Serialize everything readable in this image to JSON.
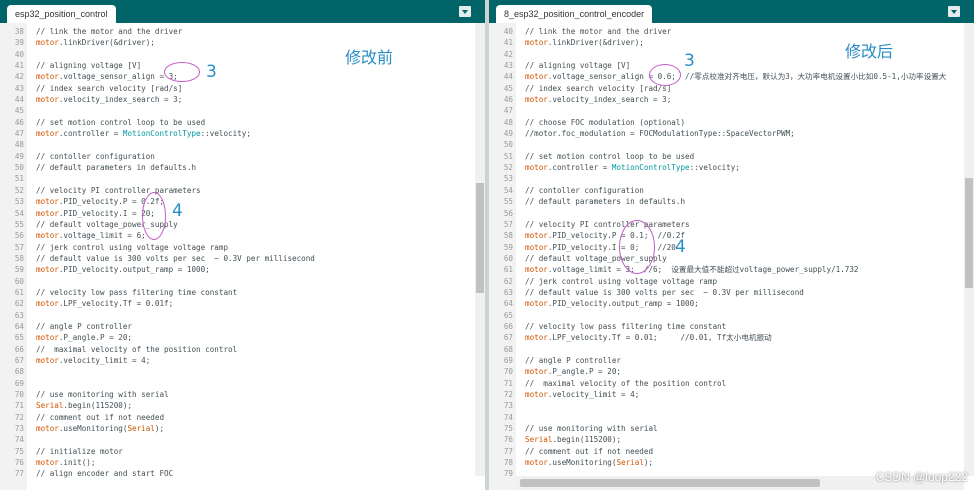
{
  "left": {
    "tab_label": "esp32_position_control",
    "annotation": "修改前",
    "mark_voltage": "3",
    "mark_pid": "4",
    "lines": [
      {
        "n": "38",
        "t": "// link the motor and the driver"
      },
      {
        "n": "39",
        "t": "motor.linkDriver(&driver);"
      },
      {
        "n": "40",
        "t": ""
      },
      {
        "n": "41",
        "t": "// aligning voltage [V]"
      },
      {
        "n": "42",
        "t": "motor.voltage_sensor_align = 3;"
      },
      {
        "n": "43",
        "t": "// index search velocity [rad/s]"
      },
      {
        "n": "44",
        "t": "motor.velocity_index_search = 3;"
      },
      {
        "n": "45",
        "t": ""
      },
      {
        "n": "46",
        "t": "// set motion control loop to be used"
      },
      {
        "n": "47",
        "t": "motor.controller = MotionControlType::velocity;"
      },
      {
        "n": "48",
        "t": ""
      },
      {
        "n": "49",
        "t": "// contoller configuration"
      },
      {
        "n": "50",
        "t": "// default parameters in defaults.h"
      },
      {
        "n": "51",
        "t": ""
      },
      {
        "n": "52",
        "t": "// velocity PI controller parameters"
      },
      {
        "n": "53",
        "t": "motor.PID_velocity.P = 0.2f;"
      },
      {
        "n": "54",
        "t": "motor.PID_velocity.I = 20;"
      },
      {
        "n": "55",
        "t": "// default voltage_power_supply"
      },
      {
        "n": "56",
        "t": "motor.voltage_limit = 6;"
      },
      {
        "n": "57",
        "t": "// jerk control using voltage voltage ramp"
      },
      {
        "n": "58",
        "t": "// default value is 300 volts per sec  ~ 0.3V per millisecond"
      },
      {
        "n": "59",
        "t": "motor.PID_velocity.output_ramp = 1000;"
      },
      {
        "n": "60",
        "t": ""
      },
      {
        "n": "61",
        "t": "// velocity low pass filtering time constant"
      },
      {
        "n": "62",
        "t": "motor.LPF_velocity.Tf = 0.01f;"
      },
      {
        "n": "63",
        "t": ""
      },
      {
        "n": "64",
        "t": "// angle P controller"
      },
      {
        "n": "65",
        "t": "motor.P_angle.P = 20;"
      },
      {
        "n": "66",
        "t": "//  maximal velocity of the position control"
      },
      {
        "n": "67",
        "t": "motor.velocity_limit = 4;"
      },
      {
        "n": "68",
        "t": ""
      },
      {
        "n": "69",
        "t": ""
      },
      {
        "n": "70",
        "t": "// use monitoring with serial"
      },
      {
        "n": "71",
        "t": "Serial.begin(115200);"
      },
      {
        "n": "72",
        "t": "// comment out if not needed"
      },
      {
        "n": "73",
        "t": "motor.useMonitoring(Serial);"
      },
      {
        "n": "74",
        "t": ""
      },
      {
        "n": "75",
        "t": "// initialize motor"
      },
      {
        "n": "76",
        "t": "motor.init();"
      },
      {
        "n": "77",
        "t": "// align encoder and start FOC"
      }
    ]
  },
  "right": {
    "tab_label": "8_esp32_position_control_encoder",
    "annotation": "修改后",
    "mark_voltage": "3",
    "mark_pid": "4",
    "lines": [
      {
        "n": "40",
        "t": "// link the motor and the driver"
      },
      {
        "n": "41",
        "t": "motor.linkDriver(&driver);"
      },
      {
        "n": "42",
        "t": ""
      },
      {
        "n": "43",
        "t": "// aligning voltage [V]"
      },
      {
        "n": "44",
        "t": "motor.voltage_sensor_align = 0.6;  //零点校准对齐电压，默认为3，大功率电机设置小比如0.5-1,小功率设置大"
      },
      {
        "n": "45",
        "t": "// index search velocity [rad/s]"
      },
      {
        "n": "46",
        "t": "motor.velocity_index_search = 3;"
      },
      {
        "n": "47",
        "t": ""
      },
      {
        "n": "48",
        "t": "// choose FOC modulation (optional)"
      },
      {
        "n": "49",
        "t": "//motor.foc_modulation = FOCModulationType::SpaceVectorPWM;"
      },
      {
        "n": "50",
        "t": ""
      },
      {
        "n": "51",
        "t": "// set motion control loop to be used"
      },
      {
        "n": "52",
        "t": "motor.controller = MotionControlType::velocity;"
      },
      {
        "n": "53",
        "t": ""
      },
      {
        "n": "54",
        "t": "// contoller configuration"
      },
      {
        "n": "55",
        "t": "// default parameters in defaults.h"
      },
      {
        "n": "56",
        "t": ""
      },
      {
        "n": "57",
        "t": "// velocity PI controller parameters"
      },
      {
        "n": "58",
        "t": "motor.PID_velocity.P = 0.1;  //0.2f"
      },
      {
        "n": "59",
        "t": "motor.PID_velocity.I = 0;    //20"
      },
      {
        "n": "60",
        "t": "// default voltage_power_supply"
      },
      {
        "n": "61",
        "t": "motor.voltage_limit = 3;  //6;  设置最大值不能超过voltage_power_supply/1.732"
      },
      {
        "n": "62",
        "t": "// jerk control using voltage voltage ramp"
      },
      {
        "n": "63",
        "t": "// default value is 300 volts per sec  ~ 0.3V per millisecond"
      },
      {
        "n": "64",
        "t": "motor.PID_velocity.output_ramp = 1000;"
      },
      {
        "n": "65",
        "t": ""
      },
      {
        "n": "66",
        "t": "// velocity low pass filtering time constant"
      },
      {
        "n": "67",
        "t": "motor.LPF_velocity.Tf = 0.01;     //0.01, Tf太小电机振动"
      },
      {
        "n": "68",
        "t": ""
      },
      {
        "n": "69",
        "t": "// angle P controller"
      },
      {
        "n": "70",
        "t": "motor.P_angle.P = 20;"
      },
      {
        "n": "71",
        "t": "//  maximal velocity of the position control"
      },
      {
        "n": "72",
        "t": "motor.velocity_limit = 4;"
      },
      {
        "n": "73",
        "t": ""
      },
      {
        "n": "74",
        "t": ""
      },
      {
        "n": "75",
        "t": "// use monitoring with serial"
      },
      {
        "n": "76",
        "t": "Serial.begin(115200);"
      },
      {
        "n": "77",
        "t": "// comment out if not needed"
      },
      {
        "n": "78",
        "t": "motor.useMonitoring(Serial);"
      },
      {
        "n": "79",
        "t": ""
      }
    ]
  },
  "watermark": "CSDN @loop222",
  "colors": {
    "tab_bar": "#006468",
    "object": "#d35400",
    "keyword": "#00979c",
    "comment": "#434f54",
    "annotation_text": "#2a8dc5",
    "annotation_circle": "#c45bc8"
  }
}
